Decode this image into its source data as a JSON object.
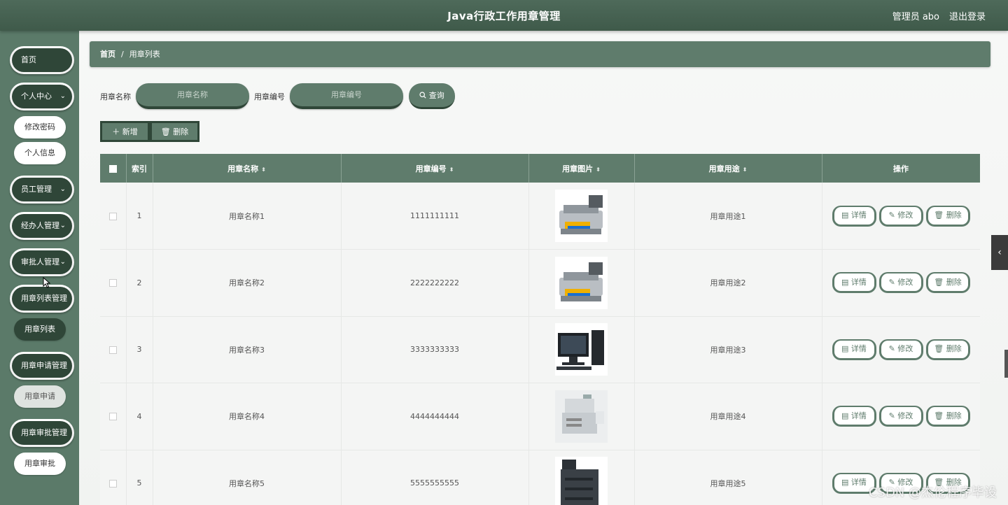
{
  "header": {
    "title": "Java行政工作用章管理",
    "user": "管理员 abo",
    "logout": "退出登录"
  },
  "sidebar": {
    "home": "首页",
    "personal_center": "个人中心",
    "change_password": "修改密码",
    "personal_info": "个人信息",
    "employee_mgmt": "员工管理",
    "handler_mgmt": "经办人管理",
    "approver_mgmt": "审批人管理",
    "seal_list_mgmt": "用章列表管理",
    "seal_list": "用章列表",
    "seal_apply_mgmt": "用章申请管理",
    "seal_apply": "用章申请",
    "seal_approve_mgmt": "用章审批管理",
    "seal_approve": "用章审批"
  },
  "breadcrumb": {
    "home": "首页",
    "sep": "/",
    "current": "用章列表"
  },
  "search": {
    "name_label": "用章名称",
    "name_placeholder": "用章名称",
    "code_label": "用章编号",
    "code_placeholder": "用章编号",
    "query_label": "查询",
    "query_icon": "search-icon"
  },
  "actions": {
    "add_label": "＋ 新增",
    "delete_label": "🗑 删除"
  },
  "table": {
    "headers": {
      "index": "索引",
      "name": "用章名称",
      "code": "用章编号",
      "image": "用章图片",
      "usage": "用章用途",
      "operations": "操作"
    },
    "row_buttons": {
      "detail": "▤ 详情",
      "edit": "✎ 修改",
      "delete": "🗑 删除"
    },
    "rows": [
      {
        "index": "1",
        "name": "用章名称1",
        "code": "1111111111",
        "image": "printer-scanner",
        "usage": "用章用途1"
      },
      {
        "index": "2",
        "name": "用章名称2",
        "code": "2222222222",
        "image": "printer-scanner",
        "usage": "用章用途2"
      },
      {
        "index": "3",
        "name": "用章名称3",
        "code": "3333333333",
        "image": "desktop-computer",
        "usage": "用章用途3"
      },
      {
        "index": "4",
        "name": "用章名称4",
        "code": "4444444444",
        "image": "office-copier",
        "usage": "用章用途4"
      },
      {
        "index": "5",
        "name": "用章名称5",
        "code": "5555555555",
        "image": "large-copier",
        "usage": "用章用途5"
      }
    ]
  },
  "watermark": "CSDN @杰伦程序毕设",
  "colors": {
    "header": "#4e6a5a",
    "sidebar": "#5b7a69",
    "accent": "#5f7c6c",
    "dark_accent": "#2f4638"
  }
}
